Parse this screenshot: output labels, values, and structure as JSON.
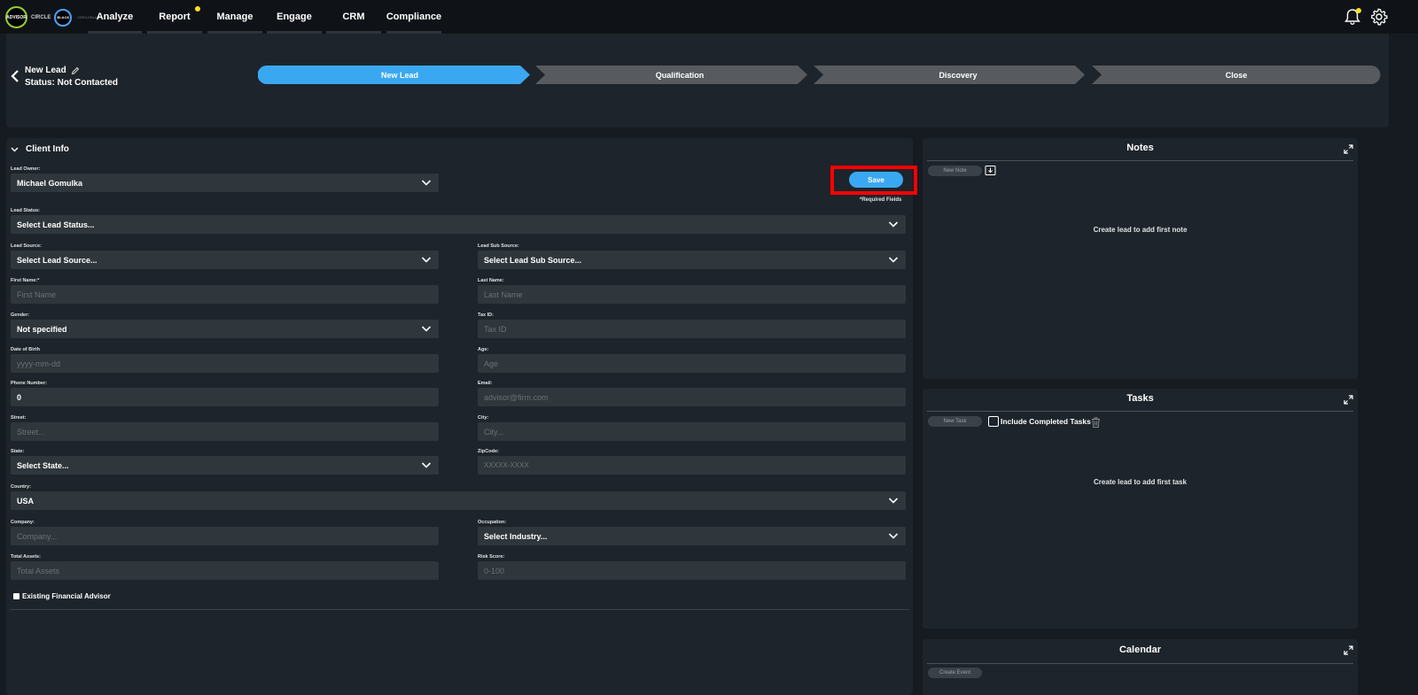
{
  "brand": {
    "logo1": "ADVISOR",
    "logo2": "BLACK",
    "logo_text": "CIRCLE",
    "logo_sub": "CIRCLEBLACK"
  },
  "nav": [
    "Analyze",
    "Report",
    "Manage",
    "Engage",
    "CRM",
    "Compliance"
  ],
  "colors": {
    "accent": "#3aa8f0",
    "highlight": "#ff0000",
    "badge": "#ffe11a",
    "stage_inactive": "#575b5f"
  },
  "lead": {
    "title": "New Lead",
    "status": "Status: Not Contacted"
  },
  "stages": [
    {
      "label": "New Lead",
      "active": true
    },
    {
      "label": "Qualification",
      "active": false
    },
    {
      "label": "Discovery",
      "active": false
    },
    {
      "label": "Close",
      "active": false
    }
  ],
  "client_info": {
    "title": "Client Info",
    "save_label": "Save",
    "required_note": "*Required Fields",
    "existing_advisor_label": "Existing Financial Advisor",
    "fields": {
      "lead_owner": {
        "label": "Lead Owner:",
        "value": "Michael Gomulka"
      },
      "lead_status": {
        "label": "Lead Status:",
        "value": "Select Lead Status..."
      },
      "lead_source": {
        "label": "Lead Source:",
        "value": "Select Lead Source..."
      },
      "lead_sub_source": {
        "label": "Lead Sub Source:",
        "value": "Select Lead Sub Source..."
      },
      "first_name": {
        "label": "First Name:*",
        "placeholder": "First Name"
      },
      "last_name": {
        "label": "Last Name:",
        "placeholder": "Last Name"
      },
      "gender": {
        "label": "Gender:",
        "value": "Not specified"
      },
      "tax_id": {
        "label": "Tax ID:",
        "placeholder": "Tax ID"
      },
      "dob": {
        "label": "Date of Birth",
        "placeholder": "yyyy-mm-dd"
      },
      "age": {
        "label": "Age:",
        "placeholder": "Age"
      },
      "phone": {
        "label": "Phone Number:",
        "value": "0"
      },
      "email": {
        "label": "Email:",
        "placeholder": "advisor@firm.com"
      },
      "street": {
        "label": "Street:",
        "placeholder": "Street..."
      },
      "city": {
        "label": "City:",
        "placeholder": "City..."
      },
      "state": {
        "label": "State:",
        "value": "Select State..."
      },
      "zip": {
        "label": "ZipCode:",
        "placeholder": "XXXXX-XXXX"
      },
      "country": {
        "label": "Country:",
        "value": "USA"
      },
      "company": {
        "label": "Company:",
        "placeholder": "Company..."
      },
      "occupation": {
        "label": "Occupation:",
        "value": "Select Industry..."
      },
      "total_assets": {
        "label": "Total Assets:",
        "placeholder": "Total Assets"
      },
      "risk_score": {
        "label": "Risk Score:",
        "placeholder": "0-100"
      }
    }
  },
  "notes": {
    "title": "Notes",
    "new_button": "New Note",
    "empty": "Create lead to add first note"
  },
  "tasks": {
    "title": "Tasks",
    "new_button": "New Task",
    "include_completed": "Include Completed Tasks",
    "empty": "Create lead to add first task"
  },
  "calendar": {
    "title": "Calendar",
    "create_button": "Create Event"
  }
}
